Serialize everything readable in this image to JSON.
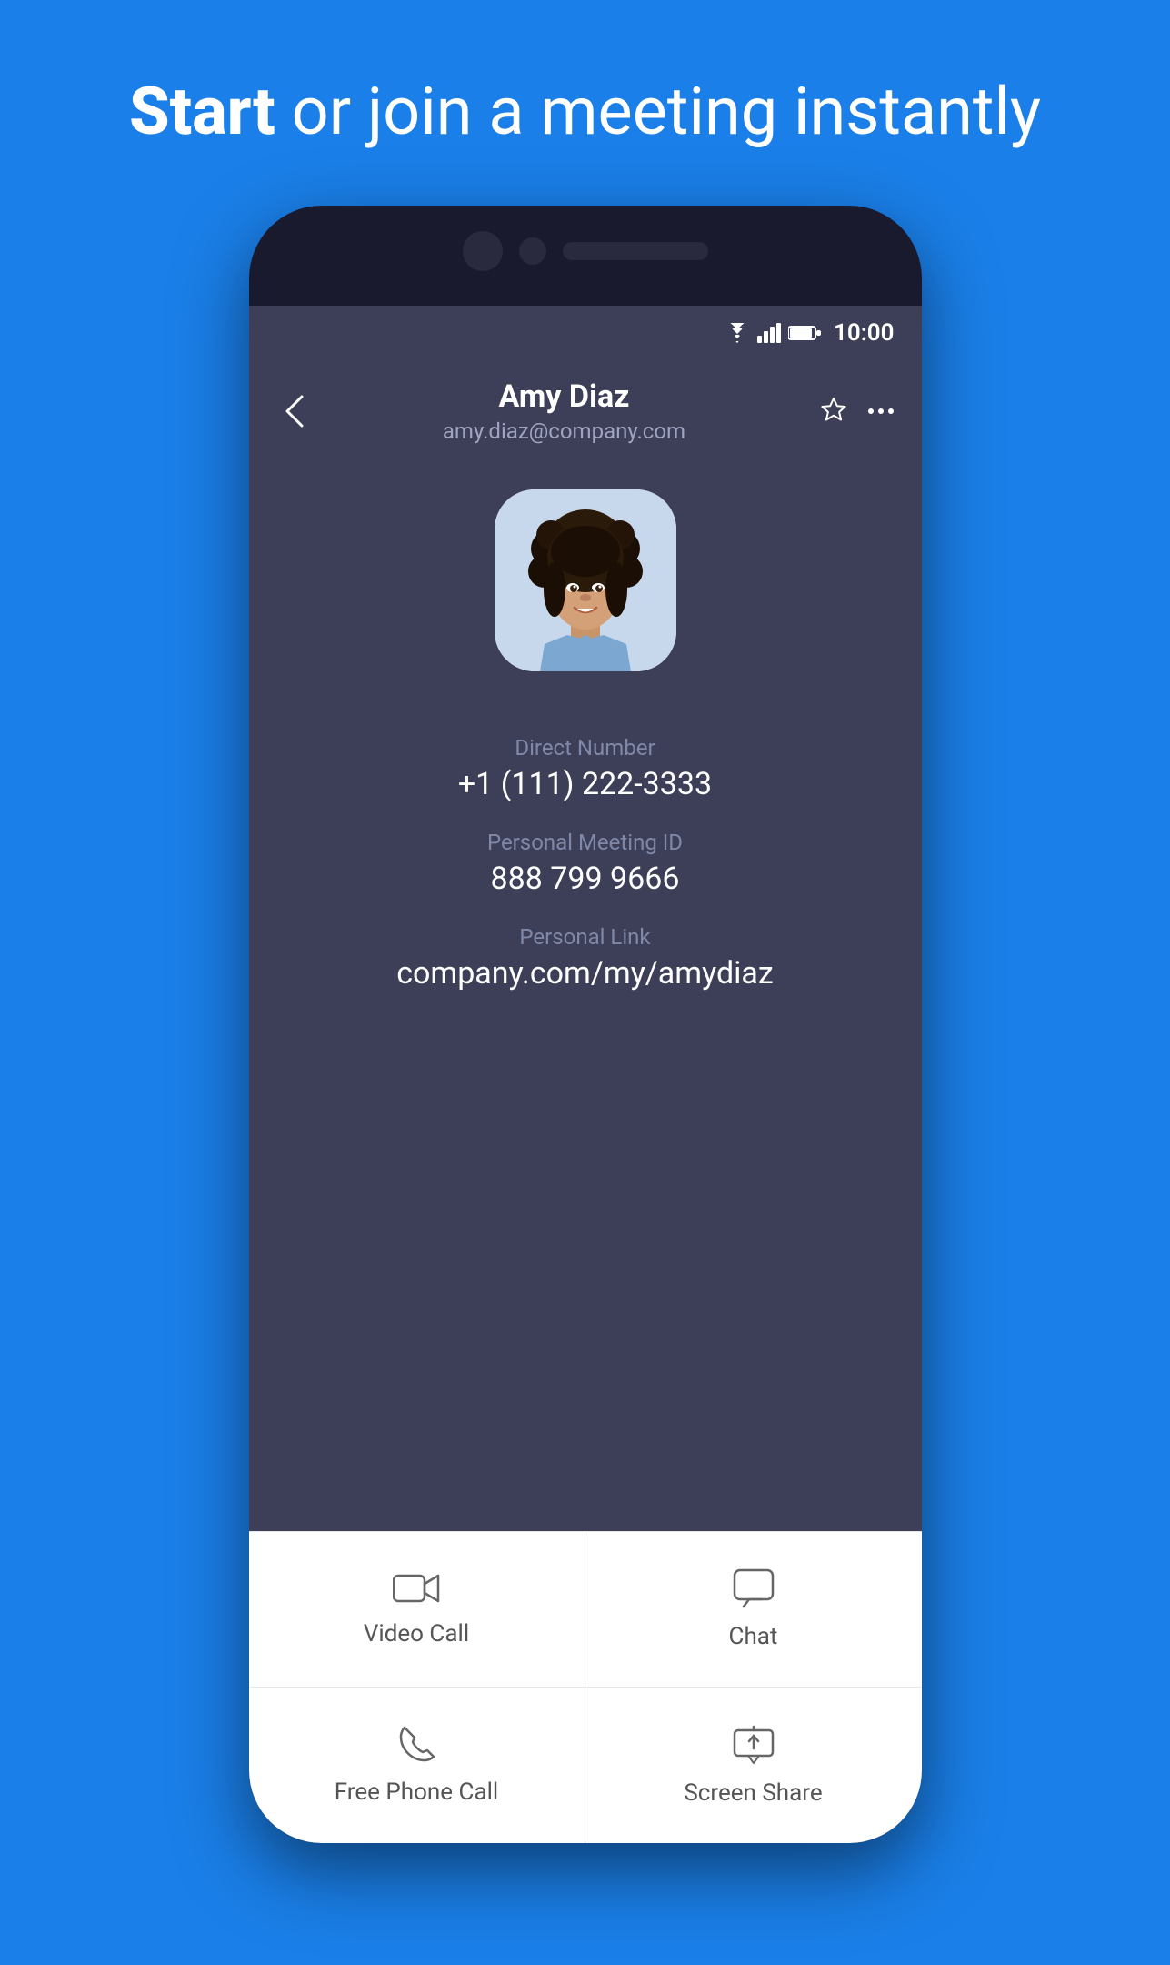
{
  "hero": {
    "title_bold": "Start",
    "title_rest": " or join a meeting instantly"
  },
  "status_bar": {
    "time": "10:00"
  },
  "contact": {
    "name": "Amy Diaz",
    "email": "amy.diaz@company.com",
    "direct_number_label": "Direct Number",
    "direct_number": "+1 (111) 222-3333",
    "meeting_id_label": "Personal Meeting ID",
    "meeting_id": "888 799 9666",
    "personal_link_label": "Personal Link",
    "personal_link": "company.com/my/amydiaz"
  },
  "actions": {
    "video_call": "Video Call",
    "chat": "Chat",
    "phone_call": "Free Phone Call",
    "screen_share": "Screen Share"
  }
}
